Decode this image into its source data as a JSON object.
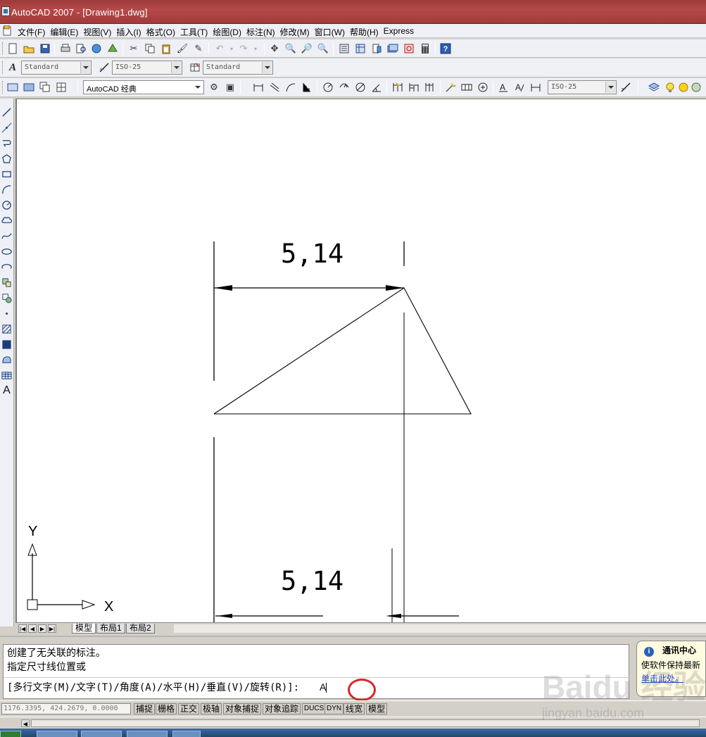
{
  "window": {
    "title": "AutoCAD 2007 - [Drawing1.dwg]"
  },
  "menu": {
    "items": [
      "文件(F)",
      "编辑(E)",
      "视图(V)",
      "插入(I)",
      "格式(O)",
      "工具(T)",
      "绘图(D)",
      "标注(N)",
      "修改(M)",
      "窗口(W)",
      "帮助(H)",
      "Express"
    ]
  },
  "styles": {
    "text_style": "Standard",
    "dim_style": "ISO-25",
    "table_style": "Standard",
    "workspace": "AutoCAD 经典",
    "dim_style_right": "ISO-25"
  },
  "drawing": {
    "top_dimension_text": "5,14",
    "bottom_dimension_text": "5,14",
    "ucs": {
      "x_label": "X",
      "y_label": "Y"
    }
  },
  "layout_tabs": [
    "模型",
    "布局1",
    "布局2"
  ],
  "command": {
    "history": [
      "创建了无关联的标注。",
      "指定尺寸线位置或"
    ],
    "prompt": "[多行文字(M)/文字(T)/角度(A)/水平(H)/垂直(V)/旋转(R)]:",
    "input_value": "A"
  },
  "comm_center": {
    "title": "通讯中心",
    "body": "使软件保持最新",
    "link": "单击此处。"
  },
  "status": {
    "coordinates": "1176.3395, 424.2679, 0.0000",
    "toggles": [
      "捕捉",
      "栅格",
      "正交",
      "极轴",
      "对象捕捉",
      "对象追踪",
      "DUCS",
      "DYN",
      "线宽",
      "模型"
    ]
  },
  "watermark": {
    "logo": "Baidu 经验",
    "url": "jingyan.baidu.com"
  },
  "colors": {
    "title_bar": "#a23b3b",
    "highlight_circle": "#d9262b",
    "link": "#1a3fd4"
  }
}
